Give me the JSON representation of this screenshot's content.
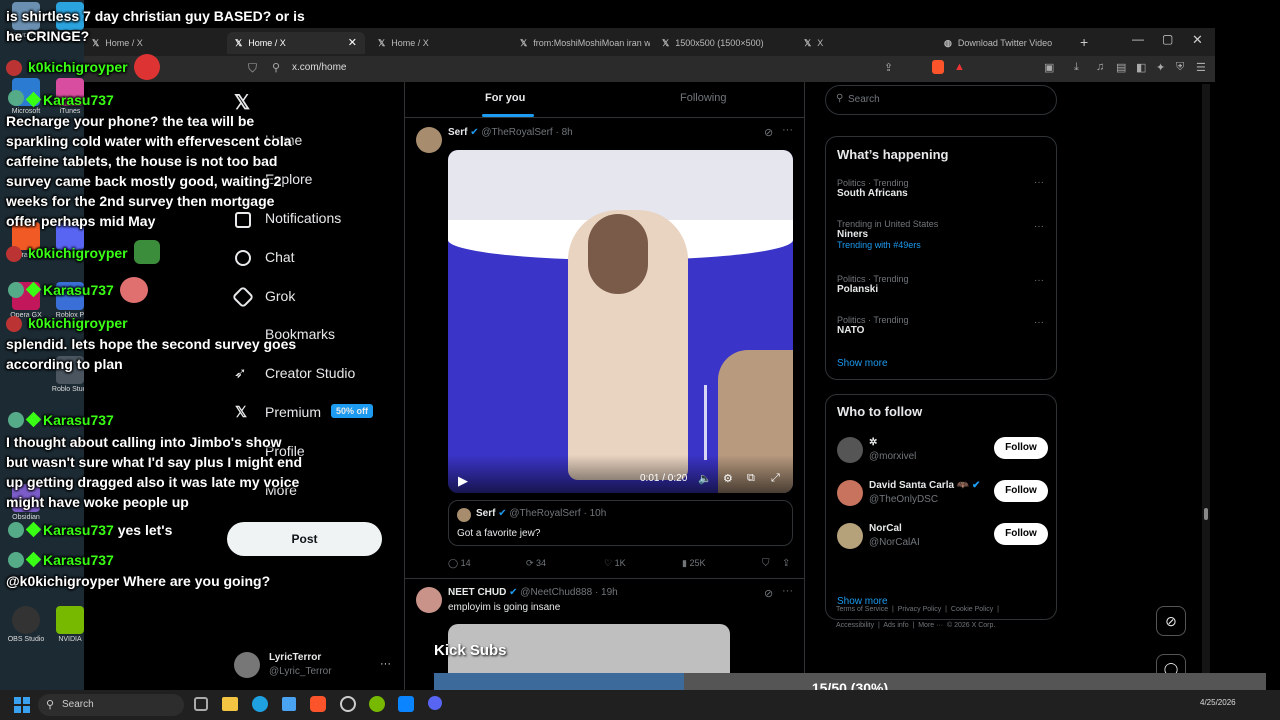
{
  "desktop_icons": [
    "Recycle Bin",
    "Telegr",
    "Microsoft",
    "iTunes",
    "Brave",
    "Disco",
    "Opera GX",
    "Roblox P",
    "Roblo Studi",
    "Obsidian",
    "OBS Studio",
    "NVIDIA"
  ],
  "tabs": [
    {
      "label": "Home / X"
    },
    {
      "label": "Home / X"
    },
    {
      "label": "Home / X"
    },
    {
      "label": "from:MoshiMoshiMoan iran w"
    },
    {
      "label": "1500x500 (1500×500)"
    },
    {
      "label": "X"
    },
    {
      "label": "Download Twitter Video"
    }
  ],
  "address": "x.com/home",
  "nav": {
    "items": [
      "Home",
      "Explore",
      "Notifications",
      "Chat",
      "Grok",
      "Bookmarks",
      "Creator Studio",
      "Premium",
      "Profile",
      "More"
    ],
    "premium_badge": "50% off",
    "post": "Post",
    "account": {
      "name": "LyricTerror",
      "handle": "@Lyric_Terror"
    }
  },
  "feed_tabs": {
    "for_you": "For you",
    "following": "Following"
  },
  "tweet1": {
    "name": "Serf",
    "handle": "@TheRoyalSerf",
    "time": "· 8h",
    "video_time": "0:01 / 0:20",
    "quote": {
      "name": "Serf",
      "handle": "@TheRoyalSerf",
      "time": "· 10h",
      "text": "Got a favorite jew?"
    },
    "stats": {
      "replies": "14",
      "reposts": "34",
      "likes": "1K",
      "views": "25K"
    }
  },
  "tweet2": {
    "name": "NEET CHUD",
    "handle": "@NeetChud888",
    "time": "· 19h",
    "text": "employim is going insane",
    "overlay": "Kick Subs"
  },
  "search_placeholder": "Search",
  "trends": {
    "heading": "What’s happening",
    "items": [
      {
        "meta": "Politics · Trending",
        "title": "South Africans",
        "extra": ""
      },
      {
        "meta": "Trending in United States",
        "title": "Niners",
        "extra": "Trending with #49ers"
      },
      {
        "meta": "Politics · Trending",
        "title": "Polanski",
        "extra": ""
      },
      {
        "meta": "Politics · Trending",
        "title": "NATO",
        "extra": ""
      }
    ],
    "show_more": "Show more"
  },
  "who_to_follow": {
    "heading": "Who to follow",
    "items": [
      {
        "name": "✲",
        "handle": "@morxivel",
        "btn": "Follow"
      },
      {
        "name": "David Santa Carla 🦇",
        "handle": "@TheOnlyDSC",
        "btn": "Follow"
      },
      {
        "name": "NorCal",
        "handle": "@NorCalAI",
        "btn": "Follow"
      }
    ],
    "show_more": "Show more"
  },
  "footer": {
    "l1": "Terms of Service  |  Privacy Policy  |  Cookie Policy  |",
    "l2": "Accessibility  |  Ads info  |  More ···  © 2026 X Corp."
  },
  "chat": [
    {
      "user": "",
      "text": "is shirtless 7 day christian guy BASED? or is he CRINGE?"
    },
    {
      "user": "k0kichigroyper",
      "text": ""
    },
    {
      "user": "Karasu737",
      "text": ""
    },
    {
      "user": "",
      "text": "Recharge your phone? the tea will be sparkling cold water with effervescent cola caffeine tablets, the house is not too bad survey came back mostly good, waiting 2 weeks for the 2nd survey then mortgage offer perhaps mid May"
    },
    {
      "user": "k0kichigroyper",
      "text": ""
    },
    {
      "user": "Karasu737",
      "text": ""
    },
    {
      "user": "k0kichigroyper",
      "text": ""
    },
    {
      "user": "",
      "text": "splendid. lets hope the second survey goes according to plan"
    },
    {
      "user": "Karasu737",
      "text": ""
    },
    {
      "user": "",
      "text": "I thought about calling into Jimbo's show but wasn't sure what I'd say plus I might end up getting dragged also it was late my voice might have woke people up"
    },
    {
      "user": "Karasu737",
      "text": "yes let's"
    },
    {
      "user": "Karasu737",
      "text": ""
    },
    {
      "user": "",
      "text": "@k0kichigroyper Where are you going?"
    }
  ],
  "progress": {
    "label": "15/50 (30%)",
    "fraction": 0.3
  },
  "taskbar": {
    "search": "Search",
    "date": "4/25/2026"
  },
  "colors": {
    "accent": "#1d9bf0",
    "name_green": "#39ff14",
    "progress_fill": "#3c6a9a"
  }
}
